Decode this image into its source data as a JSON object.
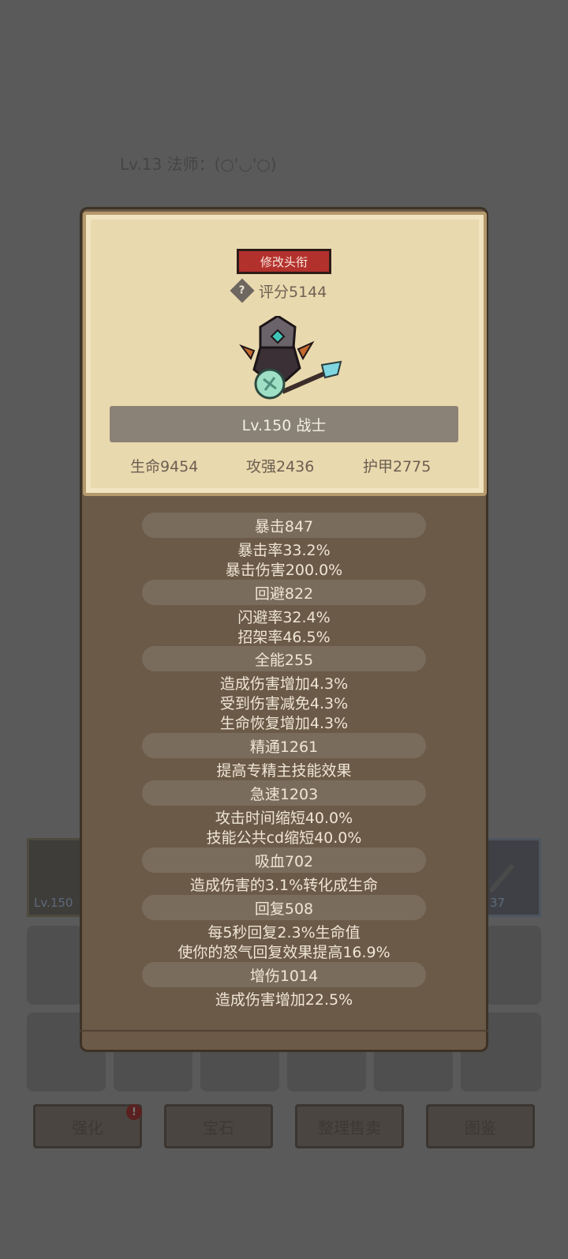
{
  "background": {
    "player_title": "Lv.13 法师：(○'◡'○)",
    "equip_left_level": "Lv.150",
    "equip_right_level": "37",
    "buttons": [
      "强化",
      "宝石",
      "整理售卖",
      "图鉴"
    ],
    "badge": "!"
  },
  "card": {
    "edit_title_button": "修改头衔",
    "score_icon": "?",
    "score": "评分5144",
    "level_class": "Lv.150 战士",
    "hp": "生命9454",
    "attack": "攻强2436",
    "armor": "护甲2775"
  },
  "stats": [
    {
      "header": "暴击847",
      "lines": [
        "暴击率33.2%",
        "暴击伤害200.0%"
      ]
    },
    {
      "header": "回避822",
      "lines": [
        "闪避率32.4%",
        "招架率46.5%"
      ]
    },
    {
      "header": "全能255",
      "lines": [
        "造成伤害增加4.3%",
        "受到伤害减免4.3%",
        "生命恢复增加4.3%"
      ]
    },
    {
      "header": "精通1261",
      "lines": [
        "提高专精主技能效果"
      ]
    },
    {
      "header": "急速1203",
      "lines": [
        "攻击时间缩短40.0%",
        "技能公共cd缩短40.0%"
      ]
    },
    {
      "header": "吸血702",
      "lines": [
        "造成伤害的3.1%转化成生命"
      ]
    },
    {
      "header": "回复508",
      "lines": [
        "每5秒回复2.3%生命值",
        "使你的怒气回复效果提高16.9%"
      ]
    },
    {
      "header": "增伤1014",
      "lines": [
        "造成伤害增加22.5%"
      ]
    }
  ]
}
